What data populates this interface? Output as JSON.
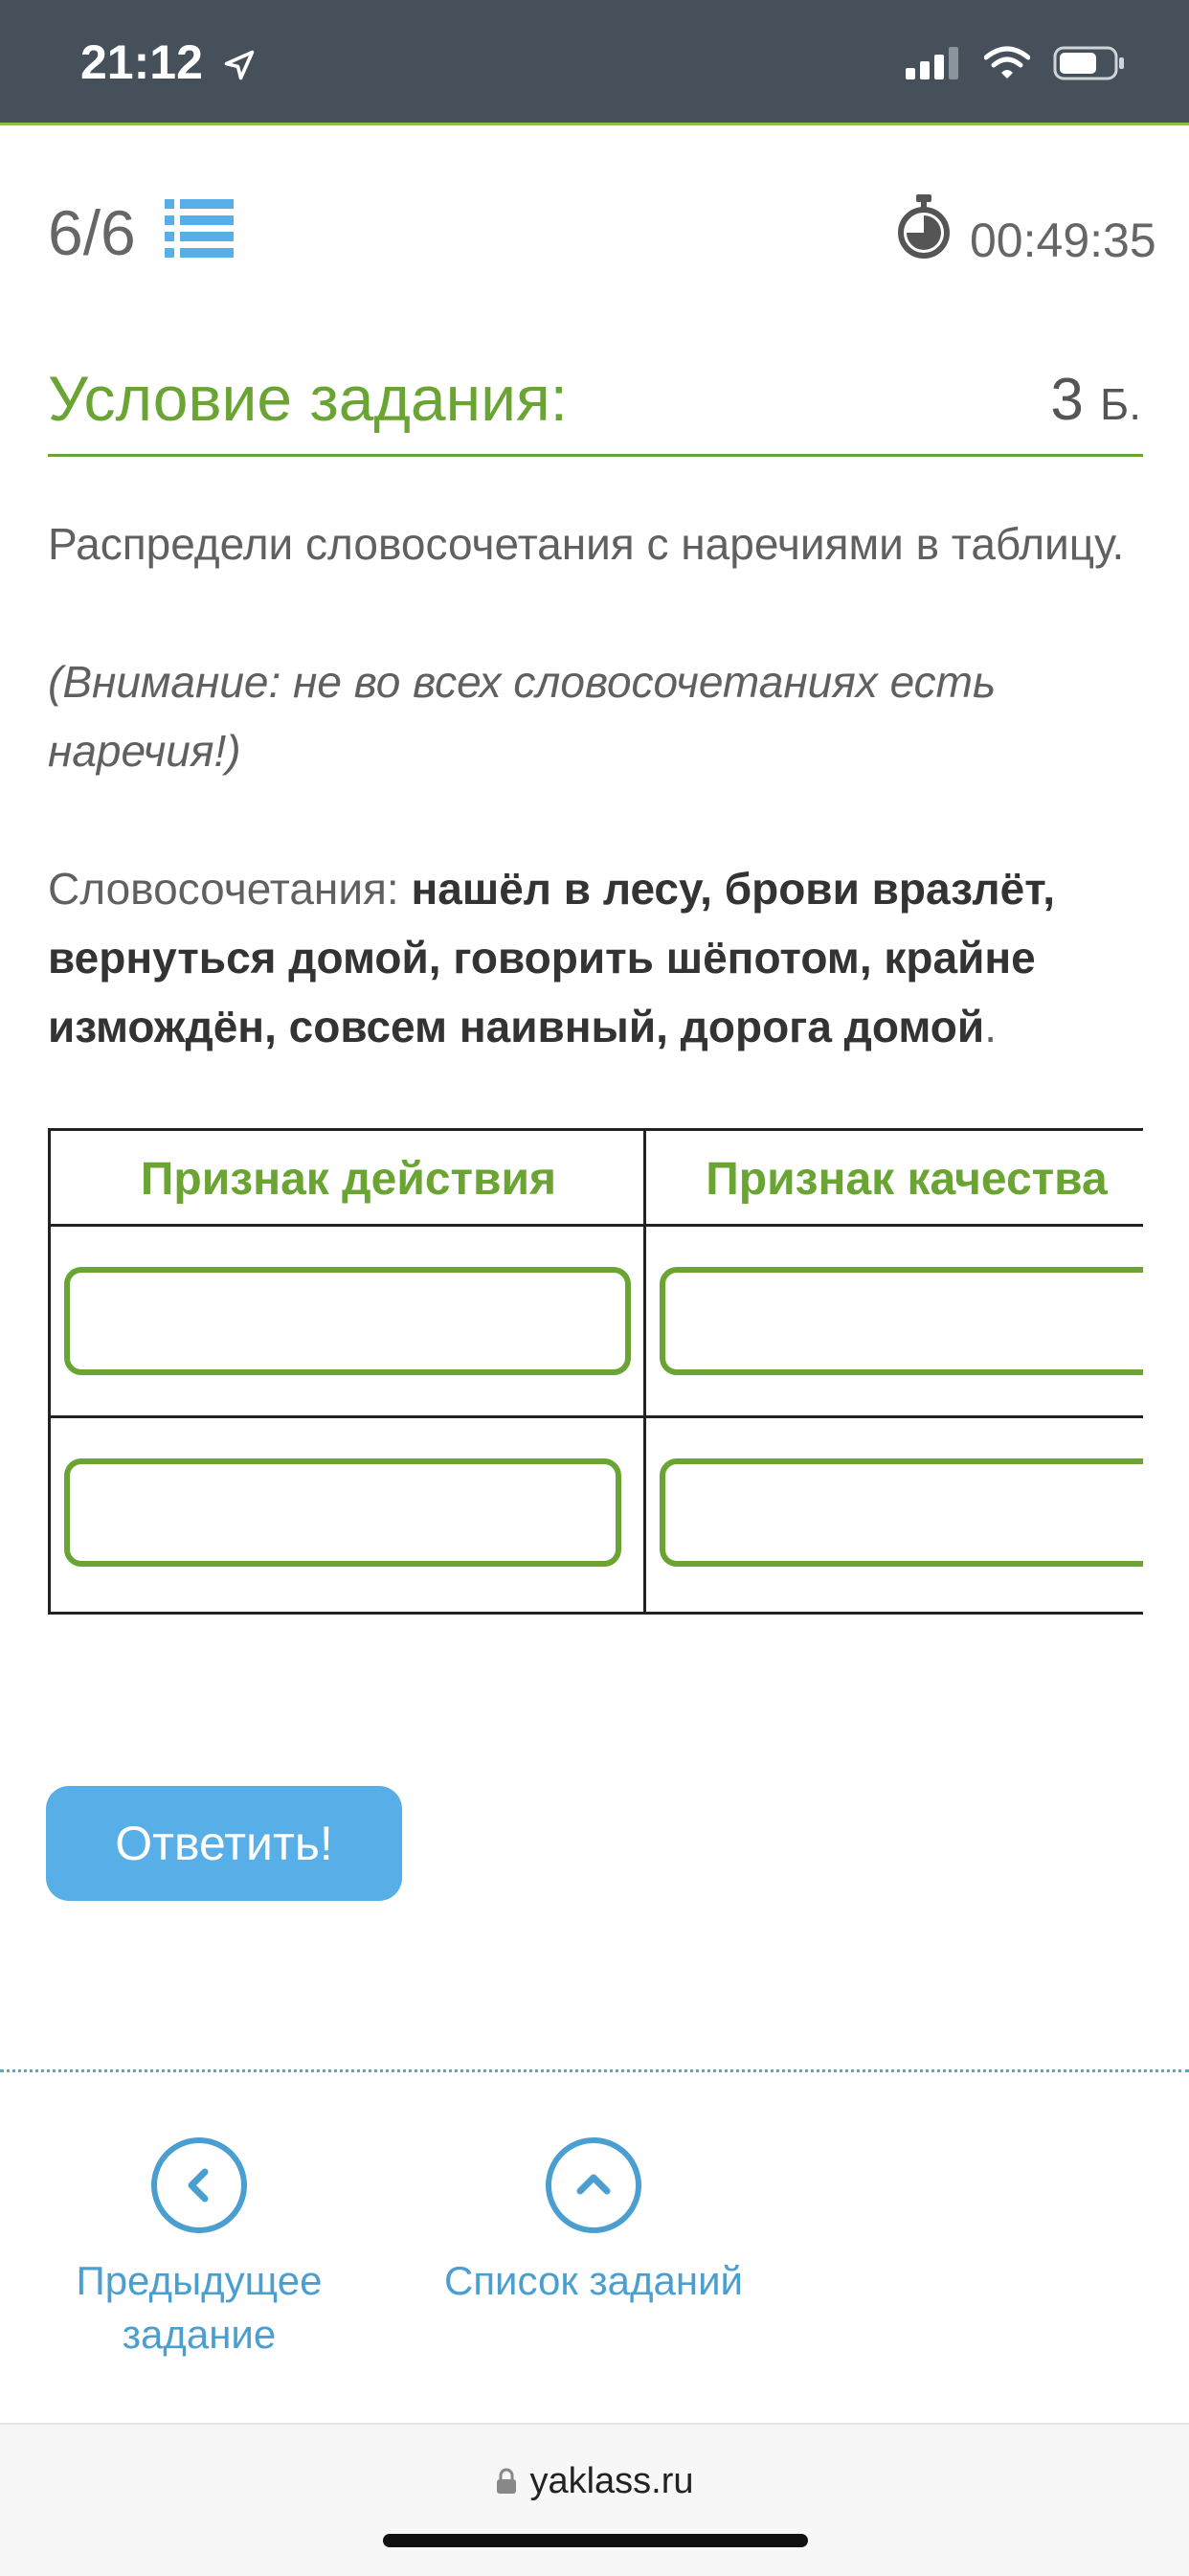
{
  "status_bar": {
    "time": "21:12",
    "location_icon": "location-arrow-icon",
    "signal_icon": "cellular-signal-icon",
    "wifi_icon": "wifi-icon",
    "battery_icon": "battery-icon"
  },
  "header": {
    "task_counter": "6/6",
    "list_icon": "list-icon",
    "timer_icon": "stopwatch-icon",
    "timer": "00:49:35"
  },
  "task": {
    "heading": "Условие задания:",
    "points_value": "3",
    "points_unit": "Б.",
    "instruction": "Распредели словосочетания с наречиями в таблицу.",
    "note": "(Внимание: не во всех словосочетаниях есть наречия!)",
    "phrases_label": "Словосочетания: ",
    "phrases": "нашёл в лесу, брови вразлёт, вернуться домой, говорить шёпотом, крайне измождён, совсем наивный, дорога домой",
    "phrases_end": "."
  },
  "table": {
    "columns": [
      "Признак действия",
      "Признак качества"
    ],
    "rows": 2
  },
  "actions": {
    "submit_label": "Ответить!"
  },
  "nav": {
    "prev_line1": "Предыдущее",
    "prev_line2": "задание",
    "list_label": "Список заданий"
  },
  "browser": {
    "url": "yaklass.ru",
    "lock_icon": "lock-icon"
  },
  "colors": {
    "accent_green": "#6aa432",
    "button_blue": "#58aee6",
    "link_blue": "#4a9fd0",
    "status_bar_bg": "#45505a"
  }
}
